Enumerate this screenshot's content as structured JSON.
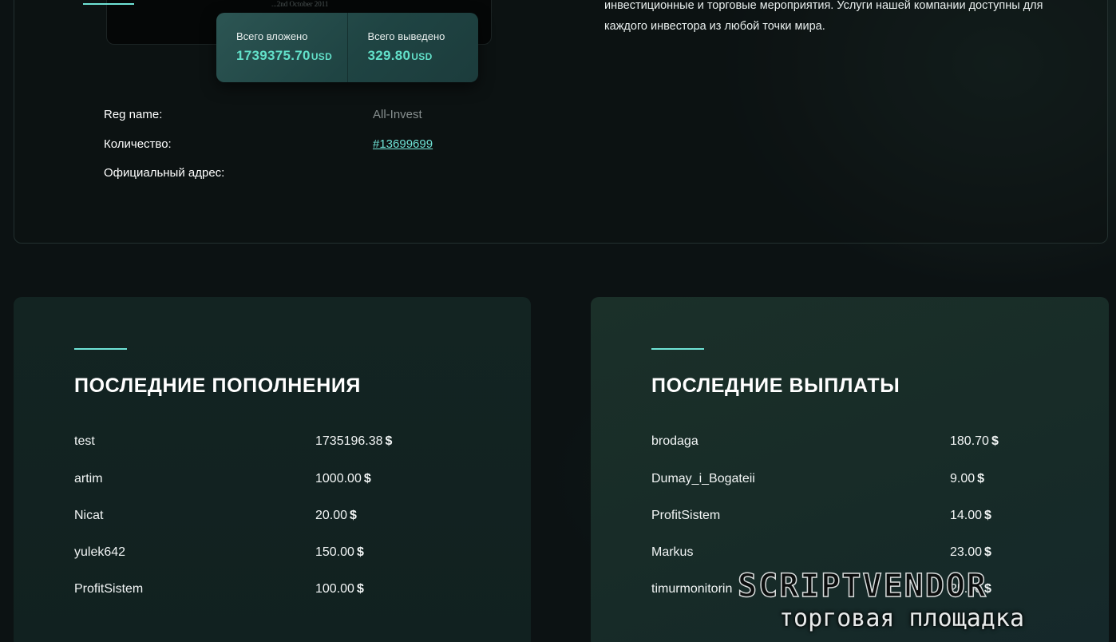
{
  "certificate": {
    "caption": "...2nd October 2011"
  },
  "stats": {
    "invested_label": "Всего вложено",
    "invested_value": "1739375.70",
    "invested_unit": "USD",
    "withdrawn_label": "Всего выведено",
    "withdrawn_value": "329.80",
    "withdrawn_unit": "USD"
  },
  "details": [
    {
      "label": "Reg name:",
      "value": "All-Invest"
    },
    {
      "label": "Количество:",
      "value": "#13699699"
    },
    {
      "label": "Официальный адрес:",
      "value": ""
    }
  ],
  "about": {
    "text": "инвестиционные и торговые мероприятия. Услуги нашей компании доступны для каждого инвестора из любой точки мира."
  },
  "deposits": {
    "title": "ПОСЛЕДНИЕ ПОПОЛНЕНИЯ",
    "currency_symbol": "$",
    "items": [
      {
        "name": "test",
        "amount": "1735196.38"
      },
      {
        "name": "artim",
        "amount": "1000.00"
      },
      {
        "name": "Nicat",
        "amount": "20.00"
      },
      {
        "name": "yulek642",
        "amount": "150.00"
      },
      {
        "name": "ProfitSistem",
        "amount": "100.00"
      }
    ]
  },
  "payouts": {
    "title": "ПОСЛЕДНИЕ ВЫПЛАТЫ",
    "currency_symbol": "$",
    "items": [
      {
        "name": "brodaga",
        "amount": "180.70"
      },
      {
        "name": "Dumay_i_Bogateii",
        "amount": "9.00"
      },
      {
        "name": "ProfitSistem",
        "amount": "14.00"
      },
      {
        "name": "Markus",
        "amount": "23.00"
      },
      {
        "name": "timurmonitorin",
        "amount": "25.00"
      }
    ]
  },
  "watermark": {
    "brand": "SCRIPTVENDOR",
    "tagline": "торговая площадка"
  },
  "colors": {
    "accent": "#6fe3d6",
    "background": "#0c1213",
    "stat_value": "#62e0c9"
  }
}
